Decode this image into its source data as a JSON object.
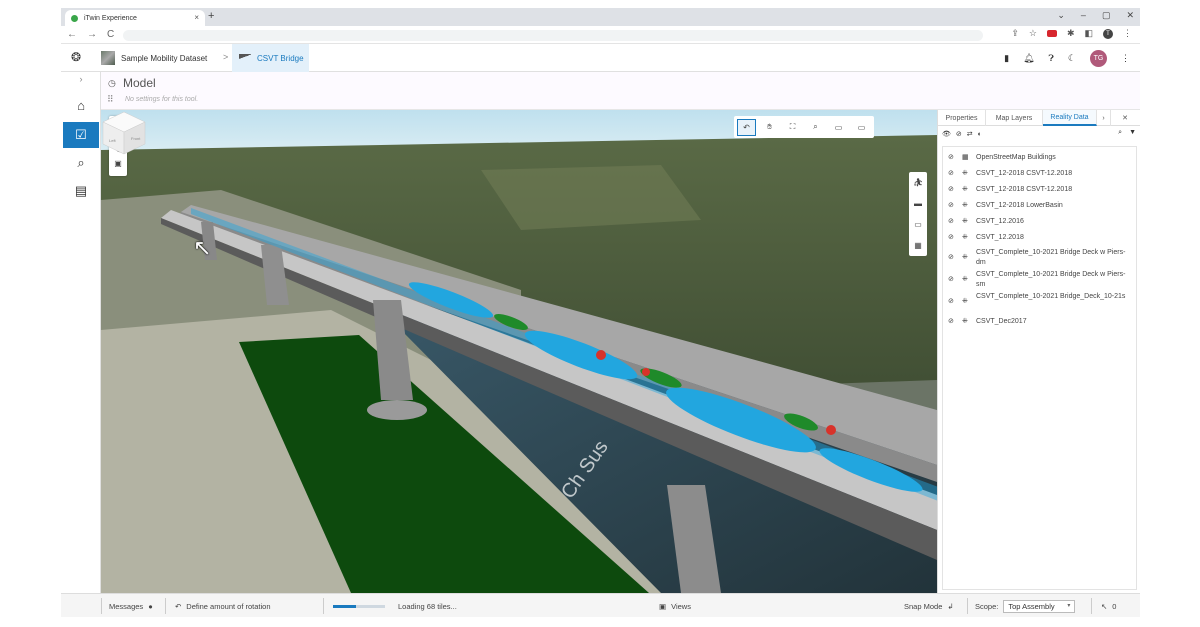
{
  "browser": {
    "tab_title": "iTwin Experience",
    "tab_close": "×",
    "new_tab": "+",
    "window_controls": [
      "⌄",
      "–",
      "▢",
      "✕"
    ],
    "nav": [
      "←",
      "→",
      "C"
    ]
  },
  "header": {
    "breadcrumb_1": "Sample Mobility Dataset",
    "breadcrumb_sep": ">",
    "breadcrumb_2": "CSVT Bridge",
    "avatar_initials": "TG",
    "menu_icon": "⋮"
  },
  "tool": {
    "title": "Model",
    "subtitle": "No settings for this tool."
  },
  "right_panel": {
    "tabs": [
      "Properties",
      "Map Layers",
      "Reality Data"
    ],
    "active_tab": "Reality Data",
    "items": [
      {
        "label": "OpenStreetMap Buildings",
        "kind": "buildings-icon"
      },
      {
        "label": "CSVT_12-2018 CSVT-12.2018",
        "kind": "pointcloud-icon"
      },
      {
        "label": "CSVT_12-2018 CSVT-12.2018",
        "kind": "pointcloud-icon"
      },
      {
        "label": "CSVT_12-2018 LowerBasin",
        "kind": "pointcloud-icon"
      },
      {
        "label": "CSVT_12.2016",
        "kind": "pointcloud-icon"
      },
      {
        "label": "CSVT_12.2018",
        "kind": "pointcloud-icon"
      },
      {
        "label": "CSVT_Complete_10-2021 Bridge Deck w Piers-dm",
        "kind": "pointcloud-icon"
      },
      {
        "label": "CSVT_Complete_10-2021 Bridge Deck w Piers-sm",
        "kind": "pointcloud-icon"
      },
      {
        "label": "CSVT_Complete_10-2021 Bridge_Deck_10-21s",
        "kind": "pointcloud-icon"
      },
      {
        "label": "CSVT_Dec2017",
        "kind": "pointcloud-icon"
      }
    ]
  },
  "viewport": {
    "cube_left": "Left",
    "cube_front": "Front",
    "map_text": "Ch Sus"
  },
  "status": {
    "messages": "Messages",
    "prompt": "Define amount of rotation",
    "loading": "Loading 68 tiles...",
    "loading_progress": 0.45,
    "views": "Views",
    "snap_mode": "Snap Mode",
    "scope_label": "Scope:",
    "scope_value": "Top Assembly",
    "selection_count": "0"
  },
  "colors": {
    "accent": "#1a7abf",
    "deck_blue": "#22a6df",
    "deck_green": "#1f8a2a",
    "deck_red": "#d8322a",
    "river_green": "#0d4a0d"
  }
}
